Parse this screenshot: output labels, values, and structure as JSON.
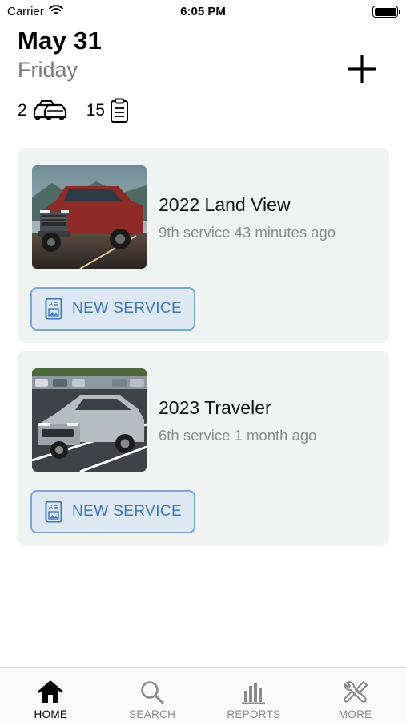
{
  "status_bar": {
    "carrier": "Carrier",
    "time": "6:05 PM"
  },
  "header": {
    "date": "May 31",
    "weekday": "Friday",
    "add_icon": "plus-icon",
    "vehicle_count": "2",
    "vehicle_icon": "cars-icon",
    "service_count": "15",
    "service_icon": "clipboard-icon"
  },
  "vehicles": [
    {
      "name": "2022 Land View",
      "meta": "9th service 43 minutes ago",
      "photo": "red-suv-photo",
      "action_label": "NEW SERVICE"
    },
    {
      "name": "2023 Traveler",
      "meta": "6th service 1 month ago",
      "photo": "silver-sedan-photo",
      "action_label": "NEW SERVICE"
    }
  ],
  "tabs": [
    {
      "label": "HOME",
      "icon": "home-icon",
      "active": true
    },
    {
      "label": "SEARCH",
      "icon": "search-icon",
      "active": false
    },
    {
      "label": "REPORTS",
      "icon": "bar-chart-icon",
      "active": false
    },
    {
      "label": "MORE",
      "icon": "tools-icon",
      "active": false
    }
  ],
  "colors": {
    "card_background": "#eff3f1",
    "button_border": "#7aa6d8",
    "button_fill": "#dde8f2",
    "button_text": "#3c76bd",
    "secondary_text": "#7a7a7a"
  }
}
